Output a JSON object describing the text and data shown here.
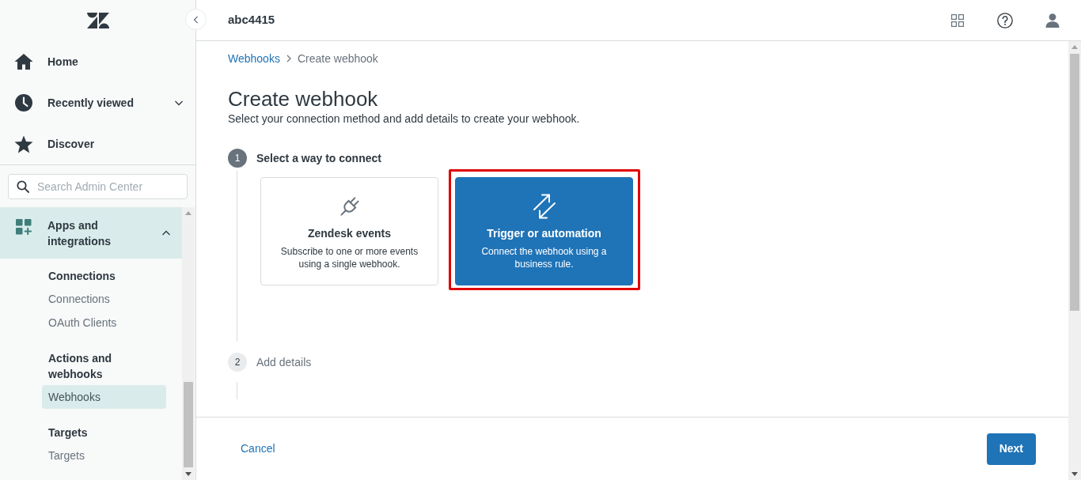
{
  "sidebar": {
    "nav": [
      {
        "kind": "home",
        "label": "Home"
      },
      {
        "kind": "recent",
        "label": "Recently viewed",
        "expanded": false
      },
      {
        "kind": "discover",
        "label": "Discover"
      }
    ],
    "search": {
      "placeholder": "Search Admin Center"
    },
    "sections": [
      {
        "label": "Apps and integrations",
        "selected": true,
        "expanded": true,
        "groups": [
          {
            "title": "Connections",
            "links": [
              {
                "label": "Connections",
                "selected": false
              },
              {
                "label": "OAuth Clients",
                "selected": false
              }
            ]
          },
          {
            "title": "Actions and webhooks",
            "links": [
              {
                "label": "Webhooks",
                "selected": true
              }
            ]
          },
          {
            "title": "Targets",
            "links": [
              {
                "label": "Targets",
                "selected": false
              }
            ]
          }
        ]
      }
    ]
  },
  "header": {
    "account": "abc4415"
  },
  "breadcrumb": [
    {
      "label": "Webhooks",
      "kind": "link"
    },
    {
      "label": "Create webhook",
      "kind": "current"
    }
  ],
  "page": {
    "title": "Create webhook",
    "subtitle": "Select your connection method and add details to create your webhook."
  },
  "steps": [
    {
      "number": "1",
      "label": "Select a way to connect",
      "active": true,
      "options": [
        {
          "kind": "events",
          "title": "Zendesk events",
          "description": "Subscribe to one or more events using a single webhook.",
          "selected": false,
          "annotated": false
        },
        {
          "kind": "rule",
          "title": "Trigger or automation",
          "description": "Connect the webhook using a business rule.",
          "selected": true,
          "annotated": true
        }
      ]
    },
    {
      "number": "2",
      "label": "Add details",
      "active": false
    }
  ],
  "footer": {
    "cancel": "Cancel",
    "next": "Next"
  }
}
